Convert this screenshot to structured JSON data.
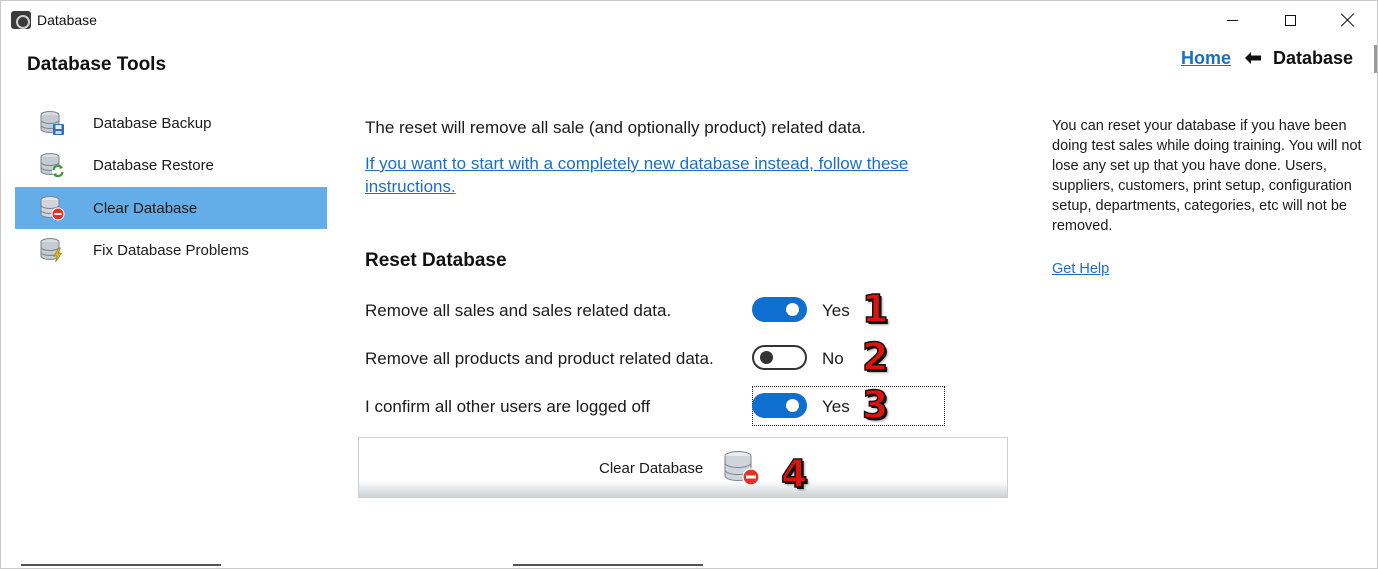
{
  "window": {
    "title": "Database",
    "icons": {
      "app": "app-logo-icon",
      "minimize": "minimize-icon",
      "maximize": "maximize-icon",
      "close": "close-icon"
    }
  },
  "sidebar": {
    "title": "Database Tools",
    "items": [
      {
        "label": "Database Backup",
        "icon": "database-backup-icon",
        "active": false
      },
      {
        "label": "Database Restore",
        "icon": "database-restore-icon",
        "active": false
      },
      {
        "label": "Clear Database",
        "icon": "database-clear-icon",
        "active": true
      },
      {
        "label": "Fix Database Problems",
        "icon": "database-fix-icon",
        "active": false
      }
    ]
  },
  "breadcrumb": {
    "home": "Home",
    "current": "Database",
    "separator_icon": "arrow-left-icon"
  },
  "main": {
    "intro": "The reset will remove all sale (and optionally product) related data.",
    "link": "If you want to start with a completely new database instead, follow these instructions.",
    "section_title": "Reset Database",
    "options": [
      {
        "label": "Remove all sales and sales related data.",
        "state": "Yes",
        "on": true,
        "step": "1"
      },
      {
        "label": "Remove all products and product related data.",
        "state": "No",
        "on": false,
        "step": "2"
      },
      {
        "label": "I confirm all other users are logged off",
        "state": "Yes",
        "on": true,
        "step": "3"
      }
    ],
    "clear_button": {
      "label": "Clear Database",
      "icon": "database-clear-icon",
      "step": "4"
    }
  },
  "info": {
    "text": "You can reset your database if you have been doing test sales while doing training. You will not lose any set up that you have done. Users, suppliers, customers, print setup, configuration setup, departments, categories, etc will not be removed.",
    "help_link": "Get Help"
  },
  "colors": {
    "accent": "#0f6fd1",
    "selected": "#63aee9",
    "link": "#1a6fc4",
    "step_number": "#e0120c"
  }
}
